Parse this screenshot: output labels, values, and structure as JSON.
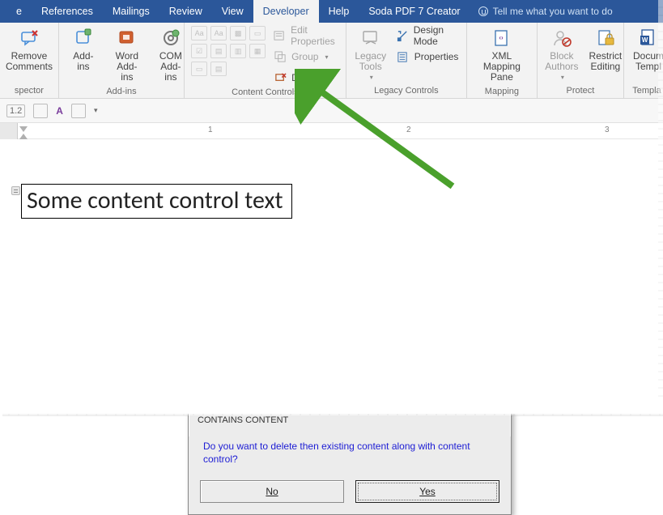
{
  "tabs": {
    "items": [
      "e",
      "References",
      "Mailings",
      "Review",
      "View",
      "Developer",
      "Help",
      "Soda PDF 7 Creator"
    ],
    "active": "Developer",
    "tellme": "Tell me what you want to do"
  },
  "ribbon": {
    "groups": {
      "spector": {
        "label": "spector",
        "removeComments": "Remove\nComments"
      },
      "addins": {
        "label": "Add-ins",
        "addins": "Add-\nins",
        "wordAddins": "Word\nAdd-ins",
        "comAddins": "COM\nAdd-ins"
      },
      "contentControls": {
        "label": "Content Controls",
        "gallery": [
          [
            "Aa",
            "Aa",
            "📰",
            "🖼"
          ],
          [
            "☑",
            "▦",
            "▤",
            "▥"
          ],
          [
            "▭",
            "▤",
            "",
            ""
          ]
        ],
        "editProperties": "Edit Properties",
        "group": "Group",
        "delete": "Delete"
      },
      "legacy": {
        "label": "Legacy Controls",
        "legacyTools": "Legacy\nTools",
        "designMode": "Design Mode",
        "properties": "Properties"
      },
      "mapping": {
        "label": "Mapping",
        "xml": "XML Mapping\nPane"
      },
      "protect": {
        "label": "Protect",
        "blockAuthors": "Block\nAuthors",
        "restrict": "Restrict\nEditing"
      },
      "templates": {
        "label": "Templa",
        "docTemplate": "Docum\nTempl"
      }
    }
  },
  "toolbar2": {
    "letter": "A"
  },
  "ruler": {
    "marks": [
      "1",
      "2",
      "3"
    ]
  },
  "document": {
    "ccText": "Some content control text"
  },
  "dialog": {
    "title": "CONTAINS CONTENT",
    "body": "Do you want to delete then existing content along with content control?",
    "no": "No",
    "yes": "Yes"
  }
}
